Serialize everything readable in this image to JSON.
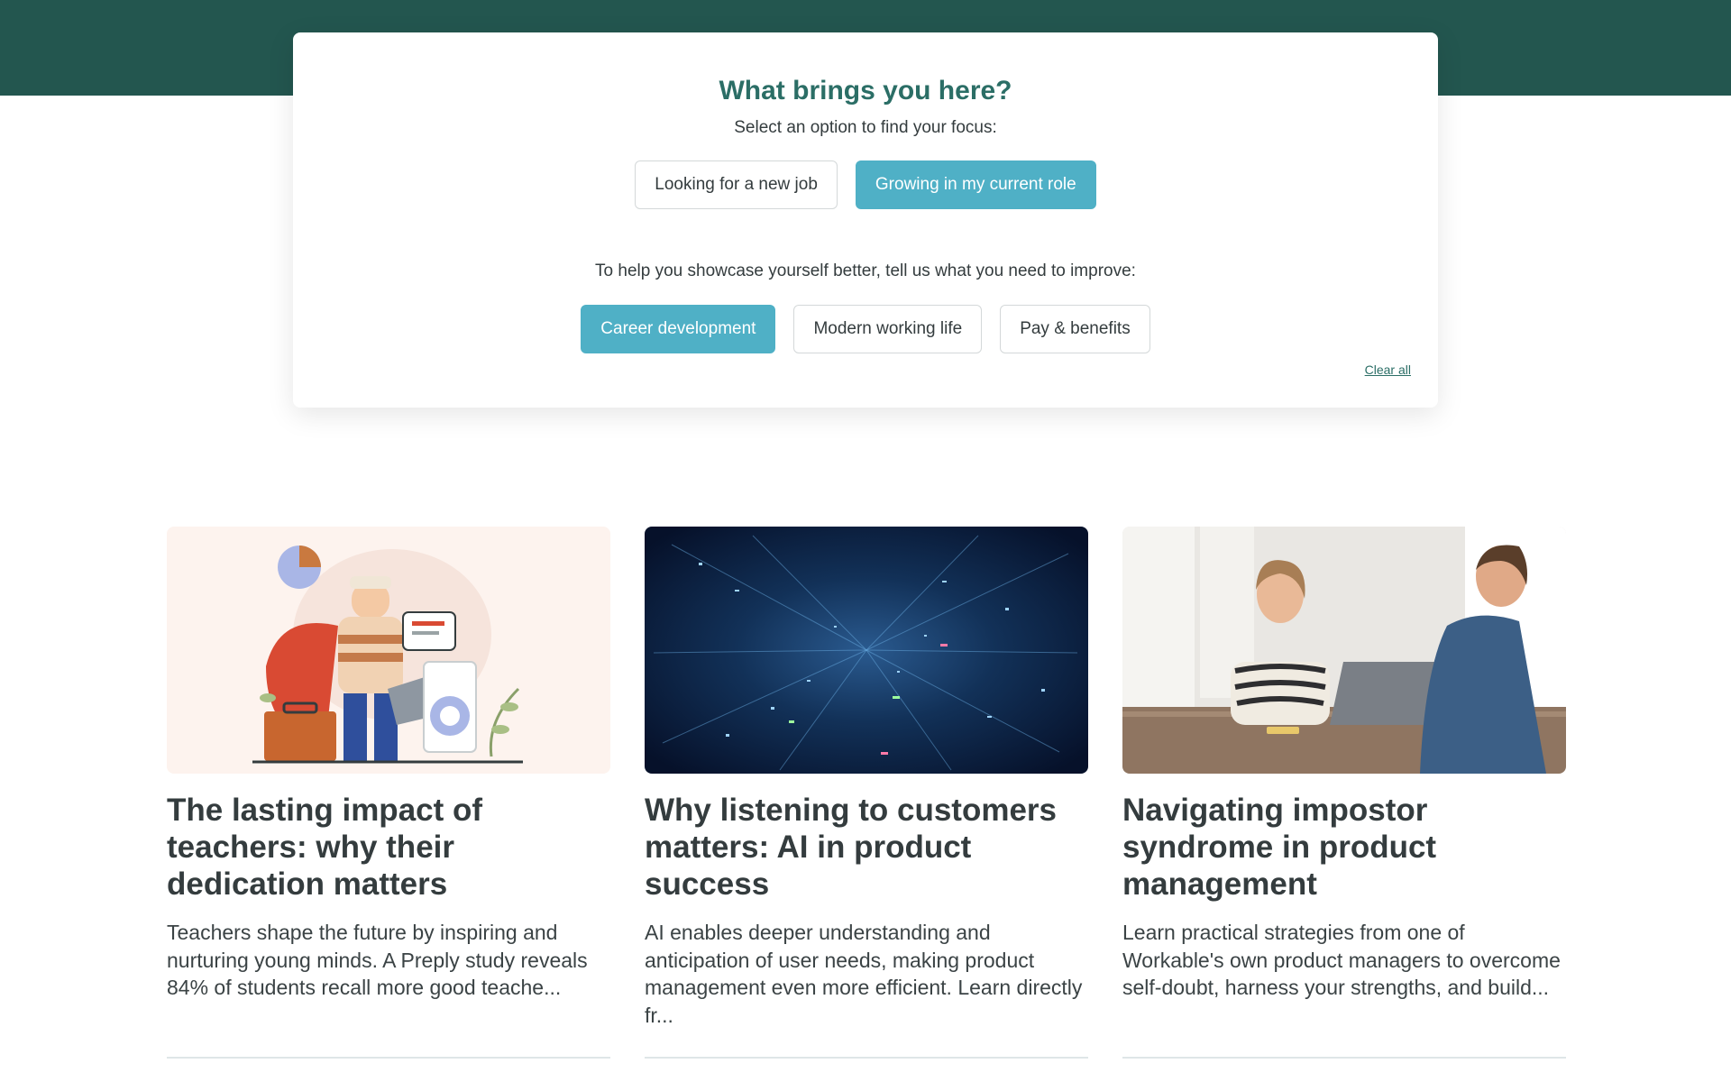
{
  "focus": {
    "title": "What brings you here?",
    "subtitle": "Select an option to find your focus:",
    "options": [
      {
        "label": "Looking for a new job",
        "selected": false
      },
      {
        "label": "Growing in my current role",
        "selected": true
      }
    ],
    "improve_prompt": "To help you showcase yourself better, tell us what you need to improve:",
    "topics": [
      {
        "label": "Career development",
        "selected": true
      },
      {
        "label": "Modern working life",
        "selected": false
      },
      {
        "label": "Pay & benefits",
        "selected": false
      }
    ],
    "clear_label": "Clear all"
  },
  "colors": {
    "header_band": "#23564f",
    "title_green": "#2b6e66",
    "selected_pill": "#4fb0c6"
  },
  "articles": [
    {
      "title": "The lasting impact of teachers: why their dedication matters",
      "excerpt": "Teachers shape the future by inspiring and nurturing young minds. A Preply study reveals 84% of students recall more good teache...",
      "image": "illustration-teacher-with-laptop-and-cape"
    },
    {
      "title": "Why listening to customers matters: AI in product success",
      "excerpt": "AI enables deeper understanding and anticipation of user needs, making product management even more efficient. Learn directly fr...",
      "image": "digital-data-tunnel"
    },
    {
      "title": "Navigating impostor syndrome in product management",
      "excerpt": "Learn practical strategies from one of Workable's own product managers to overcome self-doubt, harness your strengths, and build...",
      "image": "photo-woman-meeting-with-man"
    }
  ]
}
